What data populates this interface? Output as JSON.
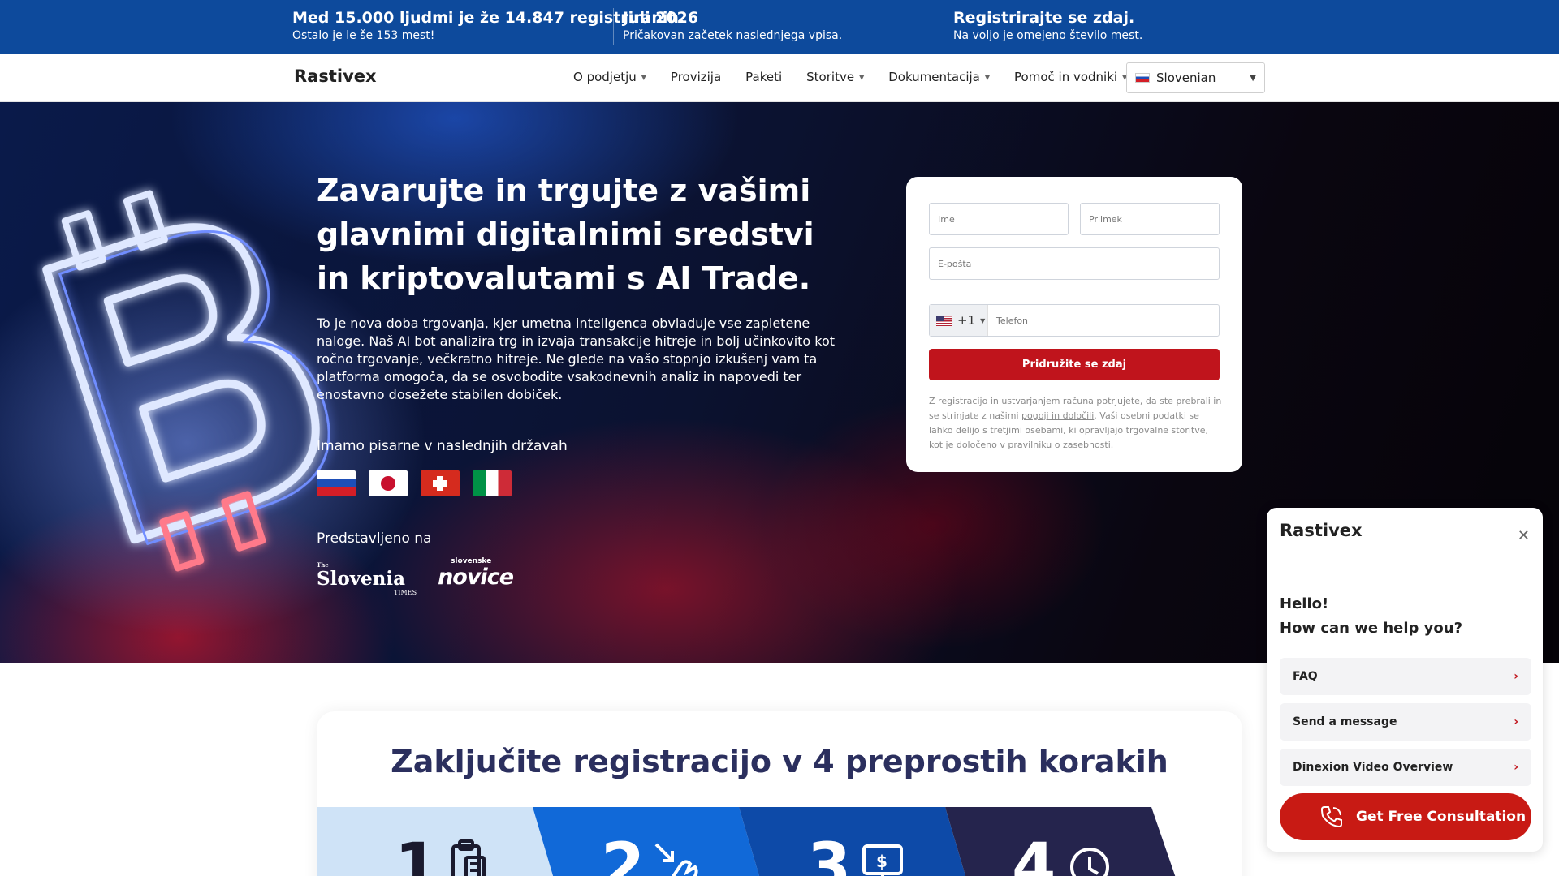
{
  "topbar": {
    "items": [
      {
        "title": "Med 15.000 ljudmi je že 14.847 registriranih.",
        "subtitle": "Ostalo je le še 153 mest!"
      },
      {
        "title": "Juli 2026",
        "subtitle": "Pričakovan začetek naslednjega vpisa."
      },
      {
        "title": "Registrirajte se zdaj.",
        "subtitle": "Na voljo je omejeno število mest."
      }
    ],
    "color": "#0d4a9c"
  },
  "nav": {
    "logo": "Rastivex",
    "menu": [
      {
        "label": "O podjetju",
        "dropdown": true
      },
      {
        "label": "Provizija",
        "dropdown": false
      },
      {
        "label": "Paketi",
        "dropdown": false
      },
      {
        "label": "Storitve",
        "dropdown": true
      },
      {
        "label": "Dokumentacija",
        "dropdown": true
      },
      {
        "label": "Pomoč in vodniki",
        "dropdown": true
      }
    ],
    "language": "Slovenian"
  },
  "hero": {
    "title": "Zavarujte in trgujte z vašimi glavnimi digitalnimi sredstvi in kriptovalutami s AI Trade.",
    "description": "To je nova doba trgovanja, kjer umetna inteligenca obvladuje vse zapletene naloge. Naš AI bot analizira trg in izvaja transakcije hitreje in bolj učinkovito kot ročno trgovanje, večkratno hitreje. Ne glede na vašo stopnjo izkušenj vam ta platforma omogoča, da se osvobodite vsakodnevnih analiz in napovedi ter enostavno dosežete stabilen dobiček.",
    "offices_label": "Imamo pisarne v naslednjih državah",
    "offices_flags": [
      "slovenia-flag-icon",
      "japan-flag-icon",
      "switzerland-flag-icon",
      "italy-flag-icon"
    ],
    "featured_label": "Predstavljeno na",
    "press": {
      "slovenia_times": {
        "small": "The",
        "name": "Slovenia",
        "suffix": "TIMES"
      },
      "novice": {
        "small": "slovenske",
        "name": "novice"
      }
    }
  },
  "form": {
    "first_name_placeholder": "Ime",
    "last_name_placeholder": "Priimek",
    "email_placeholder": "E-pošta",
    "phone_code": "+1",
    "phone_placeholder": "Telefon",
    "submit_label": "Pridružite se zdaj",
    "legal_1": "Z registracijo in ustvarjanjem računa potrjujete, da ste prebrali in se strinjate z našimi ",
    "legal_link_1": "pogoji in določili",
    "legal_2": ". Vaši osebni podatki se lahko delijo s tretjimi osebami, ki opravljajo trgovalne storitve, kot je določeno v ",
    "legal_link_2": "pravilniku o zasebnosti",
    "legal_3": ".",
    "button_color": "#c0141c"
  },
  "steps": {
    "title": "Zaključite registracijo v 4 preprostih korakih",
    "items": [
      {
        "number": "1",
        "icon": "clipboard-icon",
        "color": "#cfe3f7",
        "text_color": "#1a1a2e"
      },
      {
        "number": "2",
        "icon": "hand-click-icon",
        "color": "#1169d8",
        "text_color": "#ffffff"
      },
      {
        "number": "3",
        "icon": "money-screen-icon",
        "color": "#0d4aa8",
        "text_color": "#ffffff"
      },
      {
        "number": "4",
        "icon": "clock-icon",
        "color": "#25244d",
        "text_color": "#ffffff"
      }
    ]
  },
  "chat": {
    "brand": "Rastivex",
    "greeting_1": "Hello!",
    "greeting_2": "How can we help you?",
    "options": [
      "FAQ",
      "Send a message",
      "Dinexion Video Overview"
    ],
    "cta": "Get Free Consultation",
    "cta_color": "#c81a14"
  }
}
